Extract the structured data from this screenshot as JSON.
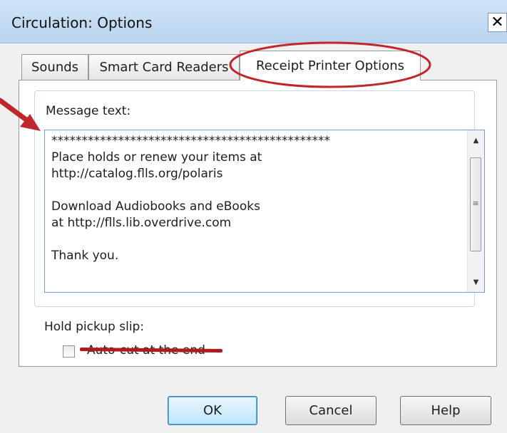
{
  "window": {
    "title": "Circulation: Options",
    "close_glyph": "✕"
  },
  "tabs": [
    {
      "label": "Sounds",
      "active": false
    },
    {
      "label": "Smart Card Readers",
      "active": false
    },
    {
      "label": "Receipt Printer Options",
      "active": true
    }
  ],
  "message": {
    "label": "Message text:",
    "value": "**********************************************\nPlace holds or renew your items at\nhttp://catalog.flls.org/polaris\n\nDownload Audiobooks and eBooks\nat http://flls.lib.overdrive.com\n\nThank you."
  },
  "scrollbar": {
    "up_glyph": "▲",
    "down_glyph": "▼",
    "grip_glyph": "≡"
  },
  "hold_pickup": {
    "label": "Hold pickup slip:",
    "checkbox_label": "Auto-cut at the end",
    "checked": false
  },
  "buttons": {
    "ok": "OK",
    "cancel": "Cancel",
    "help": "Help"
  },
  "annotation_colors": {
    "circle": "#c0272d",
    "arrow": "#c0272d",
    "strike": "#b01c1c"
  }
}
